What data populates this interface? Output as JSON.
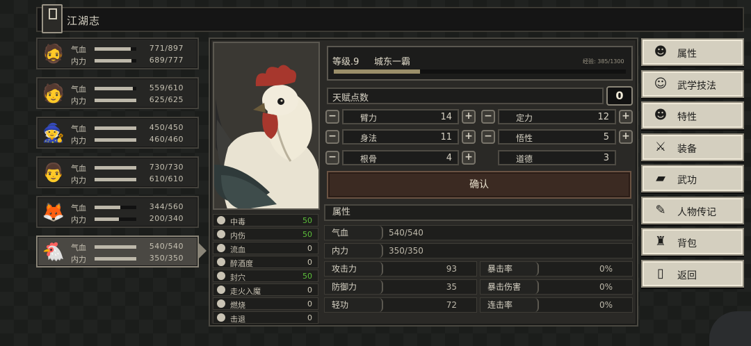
{
  "header": {
    "title": "江湖志"
  },
  "characters": [
    {
      "avatar": "🧔",
      "hp_label": "气血",
      "hp_text": "771/897",
      "hp_frac": 0.86,
      "mp_label": "内力",
      "mp_text": "689/777",
      "mp_frac": 0.89
    },
    {
      "avatar": "🧑",
      "hp_label": "气血",
      "hp_text": "559/610",
      "hp_frac": 0.92,
      "mp_label": "内力",
      "mp_text": "625/625",
      "mp_frac": 1.0
    },
    {
      "avatar": "🧙",
      "hp_label": "气血",
      "hp_text": "450/450",
      "hp_frac": 1.0,
      "mp_label": "内力",
      "mp_text": "460/460",
      "mp_frac": 1.0
    },
    {
      "avatar": "👨",
      "hp_label": "气血",
      "hp_text": "730/730",
      "hp_frac": 1.0,
      "mp_label": "内力",
      "mp_text": "610/610",
      "mp_frac": 1.0
    },
    {
      "avatar": "🦊",
      "hp_label": "气血",
      "hp_text": "344/560",
      "hp_frac": 0.61,
      "mp_label": "内力",
      "mp_text": "200/340",
      "mp_frac": 0.59
    },
    {
      "avatar": "🐔",
      "hp_label": "气血",
      "hp_text": "540/540",
      "hp_frac": 1.0,
      "mp_label": "内力",
      "mp_text": "350/350",
      "mp_frac": 1.0
    }
  ],
  "status": [
    {
      "name": "中毒",
      "value": "50",
      "color": "#5cbf3a"
    },
    {
      "name": "内伤",
      "value": "50",
      "color": "#5cbf3a"
    },
    {
      "name": "流血",
      "value": "0",
      "color": "#cfc9b8"
    },
    {
      "name": "醉酒度",
      "value": "0",
      "color": "#cfc9b8"
    },
    {
      "name": "封穴",
      "value": "50",
      "color": "#5cbf3a"
    },
    {
      "name": "走火入魔",
      "value": "0",
      "color": "#cfc9b8"
    },
    {
      "name": "燃烧",
      "value": "0",
      "color": "#cfc9b8"
    },
    {
      "name": "击退",
      "value": "0",
      "color": "#cfc9b8"
    }
  ],
  "level": {
    "level_text": "等级.9",
    "title": "城东一霸",
    "exp_text": "经验: 385/1300",
    "exp_frac": 0.296
  },
  "talent": {
    "label": "天赋点数",
    "value": "0"
  },
  "attributes": {
    "strength": {
      "name": "臂力",
      "value": "14"
    },
    "focus": {
      "name": "定力",
      "value": "12"
    },
    "agility": {
      "name": "身法",
      "value": "11"
    },
    "wisdom": {
      "name": "悟性",
      "value": "5"
    },
    "constitution": {
      "name": "根骨",
      "value": "4"
    },
    "morality": {
      "name": "道德",
      "value": "3"
    }
  },
  "confirm_label": "确认",
  "properties": {
    "header": "属性",
    "hp": {
      "label": "气血",
      "value": "540/540"
    },
    "mp": {
      "label": "内力",
      "value": "350/350"
    },
    "attack": {
      "label": "攻击力",
      "value": "93"
    },
    "crit_rate": {
      "label": "暴击率",
      "value": "0%"
    },
    "defense": {
      "label": "防御力",
      "value": "35"
    },
    "crit_damage": {
      "label": "暴击伤害",
      "value": "0%"
    },
    "qinggong": {
      "label": "轻功",
      "value": "72"
    },
    "combo_rate": {
      "label": "连击率",
      "value": "0%"
    }
  },
  "menu": [
    {
      "label": "属性",
      "icon": "person-icon"
    },
    {
      "label": "武学技法",
      "icon": "martial-skill-icon"
    },
    {
      "label": "特性",
      "icon": "trait-icon"
    },
    {
      "label": "装备",
      "icon": "sword-icon"
    },
    {
      "label": "武功",
      "icon": "book-icon"
    },
    {
      "label": "人物传记",
      "icon": "biography-icon"
    },
    {
      "label": "背包",
      "icon": "bag-icon"
    },
    {
      "label": "返回",
      "icon": "door-icon"
    }
  ]
}
